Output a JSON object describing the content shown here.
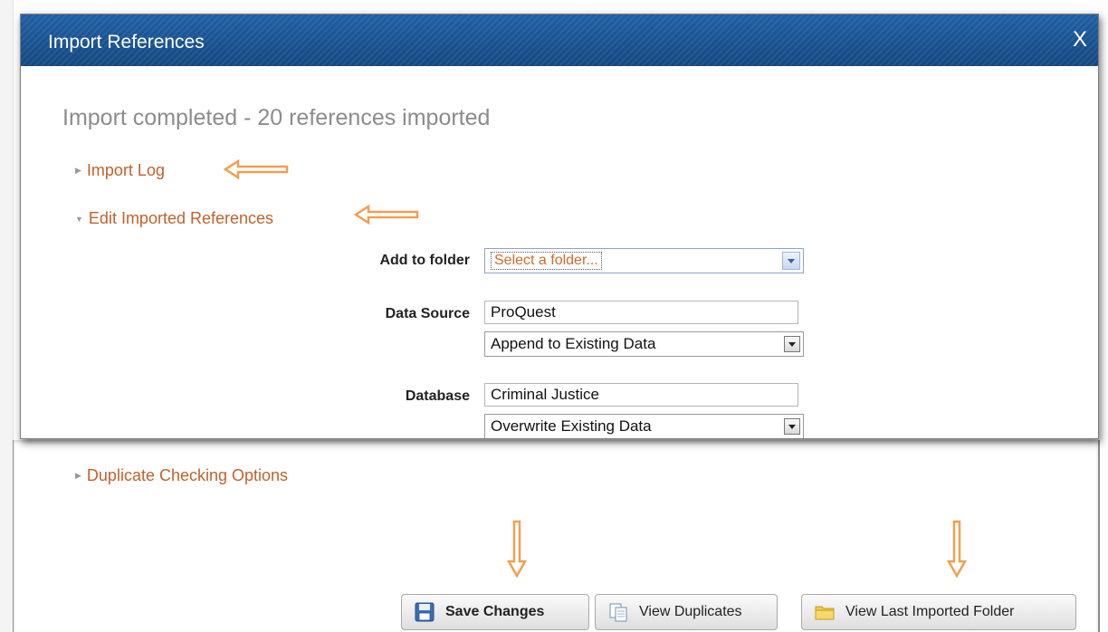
{
  "dialog": {
    "title": "Import References",
    "close_label": "X",
    "status": "Import completed - 20 references imported"
  },
  "sections": {
    "import_log": "Import Log",
    "edit_refs": "Edit Imported References",
    "duplicate_options": "Duplicate Checking Options"
  },
  "form": {
    "add_to_folder_label": "Add to folder",
    "folder_placeholder": "Select a folder...",
    "data_source_label": "Data Source",
    "data_source_value": "ProQuest",
    "data_source_mode": "Append to Existing Data",
    "database_label": "Database",
    "database_value": "Criminal Justice",
    "database_mode": "Overwrite Existing Data"
  },
  "buttons": {
    "save": "Save Changes",
    "view_duplicates": "View Duplicates",
    "view_last_folder": "View Last Imported Folder"
  },
  "icons": {
    "save": "floppy-disk-icon",
    "duplicates": "copy-documents-icon",
    "folder": "folder-icon",
    "collapsed": "triangle-right-icon",
    "expanded": "triangle-down-icon"
  },
  "colors": {
    "titlebar": "#1a5597",
    "link": "#c0622c",
    "annotation_arrow": "#f0a050"
  }
}
